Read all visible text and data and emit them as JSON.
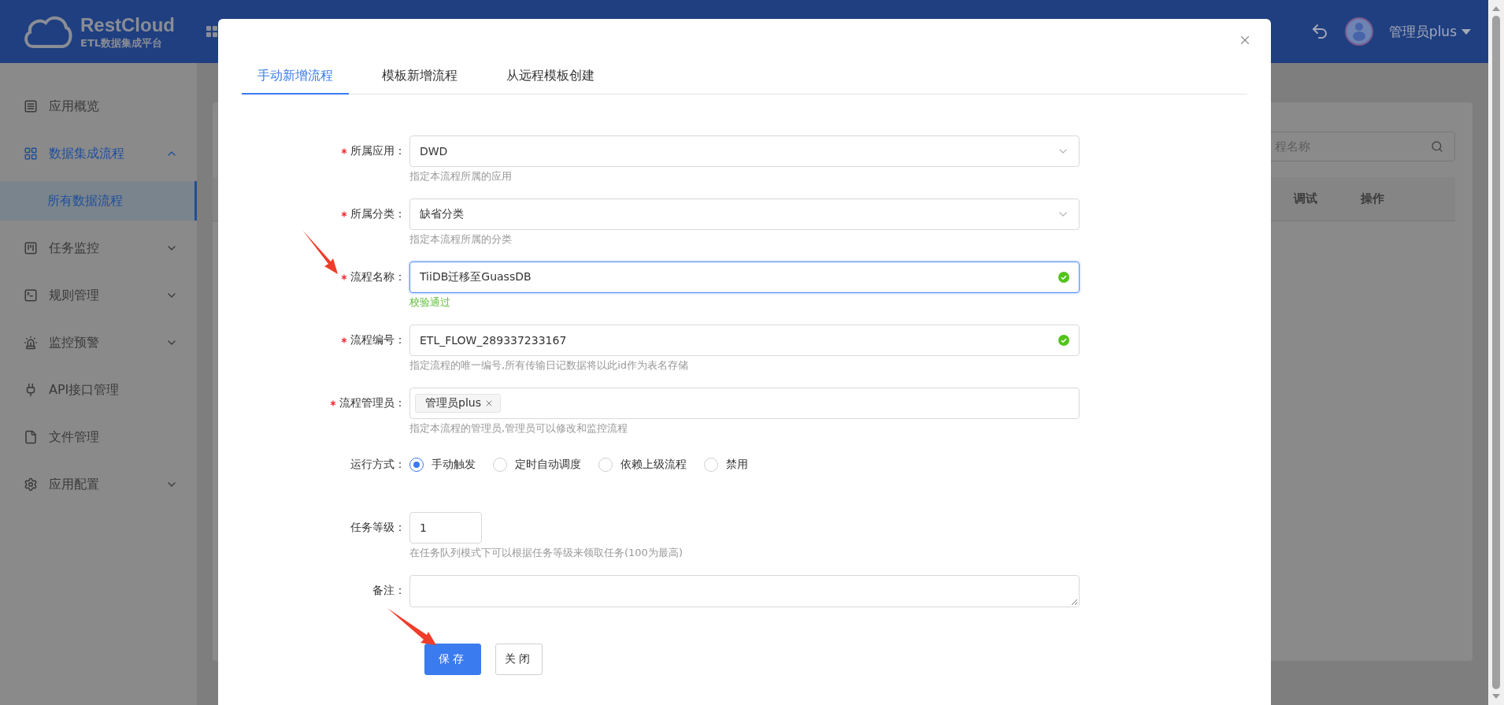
{
  "header": {
    "logo_title": "RestCloud",
    "logo_subtitle": "ETL数据集成平台",
    "user_name": "管理员plus"
  },
  "sidebar": {
    "items": [
      {
        "label": "应用概览",
        "expandable": false,
        "expanded": false,
        "selected": false
      },
      {
        "label": "数据集成流程",
        "expandable": true,
        "expanded": true,
        "selected": false,
        "children": [
          {
            "label": "所有数据流程",
            "selected": true
          }
        ]
      },
      {
        "label": "任务监控",
        "expandable": true,
        "expanded": false,
        "selected": false
      },
      {
        "label": "规则管理",
        "expandable": true,
        "expanded": false,
        "selected": false
      },
      {
        "label": "监控预警",
        "expandable": true,
        "expanded": false,
        "selected": false
      },
      {
        "label": "API接口管理",
        "expandable": false,
        "expanded": false,
        "selected": false
      },
      {
        "label": "文件管理",
        "expandable": false,
        "expanded": false,
        "selected": false
      },
      {
        "label": "应用配置",
        "expandable": true,
        "expanded": false,
        "selected": false
      }
    ]
  },
  "background": {
    "search_placeholder": "程名称",
    "table_columns": [
      "调试",
      "操作"
    ]
  },
  "modal": {
    "tabs": [
      {
        "label": "手动新增流程",
        "selected": true
      },
      {
        "label": "模板新增流程",
        "selected": false
      },
      {
        "label": "从远程模板创建",
        "selected": false
      }
    ],
    "fields": [
      {
        "kind": "select",
        "label": "所属应用：",
        "required": true,
        "value": "DWD",
        "hint": "指定本流程所属的应用",
        "valid": false
      },
      {
        "kind": "select",
        "label": "所属分类：",
        "required": true,
        "value": "缺省分类",
        "hint": "指定本流程所属的分类",
        "valid": false
      },
      {
        "kind": "input",
        "label": "流程名称：",
        "required": true,
        "value": "TiiDB迁移至GuassDB",
        "message": "校验通过",
        "valid": true,
        "focused": true
      },
      {
        "kind": "input",
        "label": "流程编号：",
        "required": true,
        "value": "ETL_FLOW_289337233167",
        "hint": "指定流程的唯一编号,所有传输日记数据将以此id作为表名存储",
        "valid": true
      },
      {
        "kind": "tags",
        "label": "流程管理员：",
        "required": true,
        "tags": [
          "管理员plus"
        ],
        "hint": "指定本流程的管理员,管理员可以修改和监控流程",
        "valid": false
      },
      {
        "kind": "radio",
        "label": "运行方式：",
        "required": false,
        "options": [
          {
            "label": "手动触发",
            "selected": true
          },
          {
            "label": "定时自动调度",
            "selected": false
          },
          {
            "label": "依赖上级流程",
            "selected": false
          },
          {
            "label": "禁用",
            "selected": false
          }
        ]
      },
      {
        "kind": "number",
        "label": "任务等级：",
        "required": false,
        "value": "1",
        "hint": "在任务队列模式下可以根据任务等级来领取任务(100为最高)",
        "valid": false
      },
      {
        "kind": "textarea",
        "label": "备注：",
        "required": false
      }
    ],
    "buttons": [
      {
        "label": "保存",
        "primary": true
      },
      {
        "label": "关闭",
        "primary": false
      }
    ]
  }
}
